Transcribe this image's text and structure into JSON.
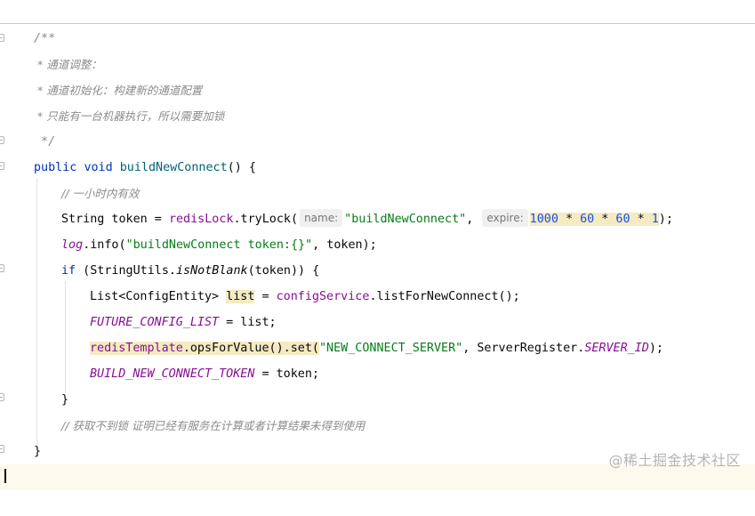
{
  "javadoc": {
    "open": "/**",
    "line1": " * 通道调整：",
    "line2": " * 通道初始化：构建新的通道配置",
    "line3": " * 只能有一台机器执行，所以需要加锁",
    "close": " */"
  },
  "method_sig": {
    "modifier1": "public",
    "modifier2": "void",
    "name": "buildNewConnect",
    "tail": "() {"
  },
  "comment_expire": "// 一小时内有效",
  "line_token": {
    "type": "String token = ",
    "receiver": "redisLock",
    "call": ".tryLock(",
    "hint_name": "name:",
    "arg1": "\"buildNewConnect\"",
    "sep": ", ",
    "hint_expire": "expire:",
    "n1": "1000",
    "op1": " * ",
    "n2": "60",
    "op2": " * ",
    "n3": "60",
    "op3": " * ",
    "n4": "1",
    "end": ");"
  },
  "line_log": {
    "logger": "log",
    "call": ".info(",
    "arg": "\"buildNewConnect token:{}\"",
    "end": ", token);"
  },
  "line_if": {
    "kw": "if",
    "p1": " (StringUtils.",
    "method": "isNotBlank",
    "p2": "(token)) {"
  },
  "line_list": {
    "type": "List<ConfigEntity> ",
    "var": "list",
    "mid": " = ",
    "service": "configService",
    "call": ".listForNewConnect();"
  },
  "line_future": {
    "field": "FUTURE_CONFIG_LIST",
    "rest": " = list;"
  },
  "line_redis": {
    "field": "redisTemplate",
    "call": ".opsForValue().set(",
    "arg1": "\"NEW_CONNECT_SERVER\"",
    "mid": ", ServerRegister.",
    "const": "SERVER_ID",
    "end": ");"
  },
  "line_token_set": {
    "field": "BUILD_NEW_CONNECT_TOKEN",
    "rest": " = token;"
  },
  "close_if": "}",
  "comment_fail": "// 获取不到锁 证明已经有服务在计算或者计算结果未得到使用",
  "close_method": "}",
  "watermark": "@稀土掘金技术社区"
}
